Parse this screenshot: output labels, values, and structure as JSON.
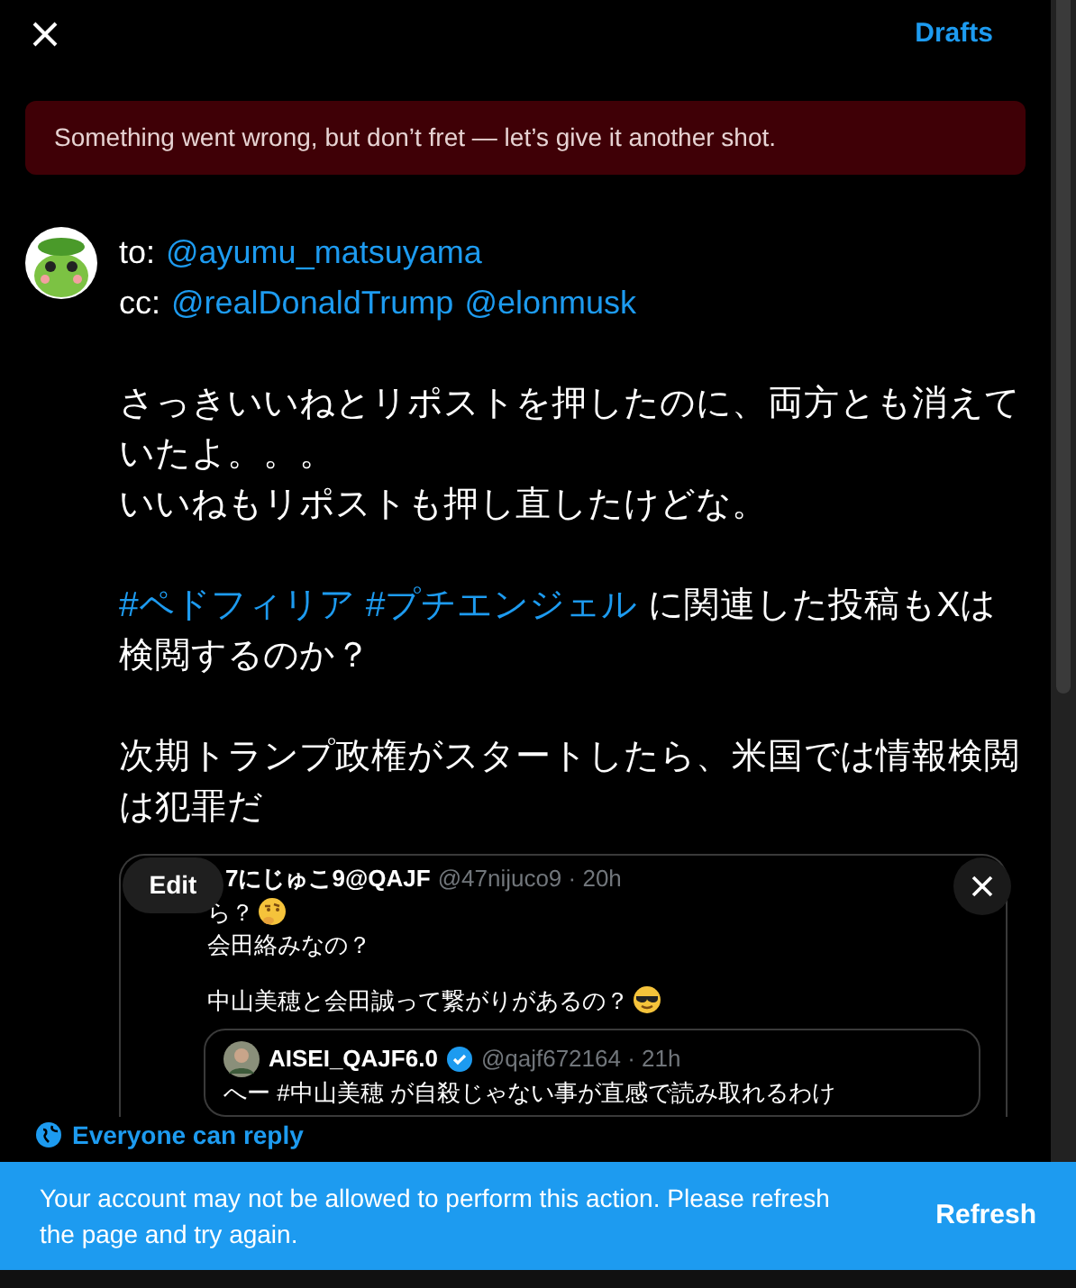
{
  "header": {
    "drafts": "Drafts"
  },
  "error_banner": "Something went wrong, but don’t fret — let’s give it another shot.",
  "compose": {
    "to_label": "to:",
    "to": "@ayumu_matsuyama",
    "cc_label": "cc:",
    "cc": [
      "@realDonaldTrump",
      "@elonmusk"
    ],
    "paragraphs": [
      {
        "lines": [
          [
            {
              "kind": "text",
              "text": "さっきいいねとリポストを押したのに、両方とも消えていたよ。。。"
            }
          ],
          [
            {
              "kind": "text",
              "text": "いいねもリポストも押し直したけどな。"
            }
          ]
        ]
      },
      {
        "lines": [
          [
            {
              "kind": "hashtag",
              "text": "#ペドフィリア"
            },
            {
              "kind": "hashtag",
              "text": "#プチエンジェル"
            },
            {
              "kind": "text",
              "text": "に関連した投稿もXは検閲するのか？"
            }
          ]
        ]
      },
      {
        "lines": [
          [
            {
              "kind": "text",
              "text": "次期トランプ政権がスタートしたら、米国では情報検閲は犯罪だ"
            }
          ]
        ]
      }
    ]
  },
  "quote": {
    "author": "7にじゅこ9@QAJF",
    "handle": "@47nijuco9 · 20h",
    "edit": "Edit",
    "paragraphs": [
      {
        "lines": [
          [
            {
              "kind": "text",
              "text": "ら？"
            },
            {
              "kind": "thinking_emoji"
            }
          ],
          [
            {
              "kind": "text",
              "text": "会田絡みなの？"
            }
          ]
        ]
      },
      {
        "lines": [
          [
            {
              "kind": "text",
              "text": "中山美穂と会田誠って繋がりがあるの？"
            },
            {
              "kind": "sunglasses_emoji"
            }
          ]
        ]
      }
    ],
    "inner": {
      "author": "AISEI_QAJF6.0",
      "verified": true,
      "handle": "@qajf672164 · 21h",
      "text": "へー #中山美穂 が自殺じゃない事が直感で読み取れるわけ"
    }
  },
  "reply_setting": "Everyone can reply",
  "toast": {
    "message": "Your account may not be allowed to perform this action. Please refresh the page and try again.",
    "action": "Refresh"
  }
}
